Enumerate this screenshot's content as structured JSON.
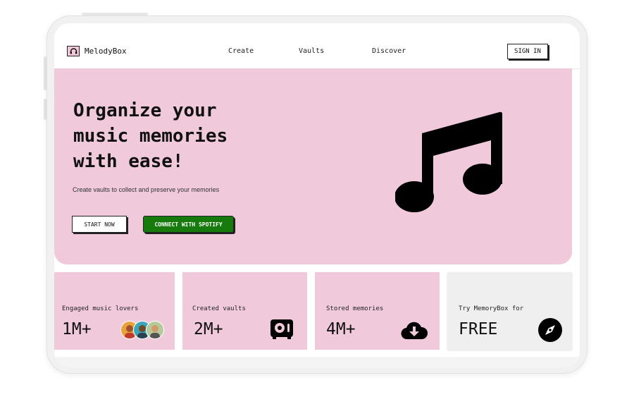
{
  "app": {
    "name": "MelodyBox"
  },
  "nav": {
    "links": [
      "Create",
      "Vaults",
      "Discover"
    ],
    "sign_in": "SIGN IN"
  },
  "hero": {
    "headline_lines": [
      "Organize your",
      "music memories",
      "with ease!"
    ],
    "subtitle": "Create vaults to collect and preserve your memories",
    "start_button": "START NOW",
    "spotify_button": "CONNECT WITH SPOTIFY",
    "icon": "music-note-icon"
  },
  "stats": [
    {
      "label": "Engaged music lovers",
      "value": "1M+",
      "icon": "avatars"
    },
    {
      "label": "Created vaults",
      "value": "2M+",
      "icon": "vault-icon"
    },
    {
      "label": "Stored memories",
      "value": "4M+",
      "icon": "cloud-download-icon"
    },
    {
      "label": "Try MemoryBox for",
      "value": "FREE",
      "icon": "compass-icon"
    }
  ],
  "colors": {
    "accent_pink": "#f0c9db",
    "spotify_green": "#167a0d",
    "dark": "#111111",
    "free_card": "#efefef"
  }
}
